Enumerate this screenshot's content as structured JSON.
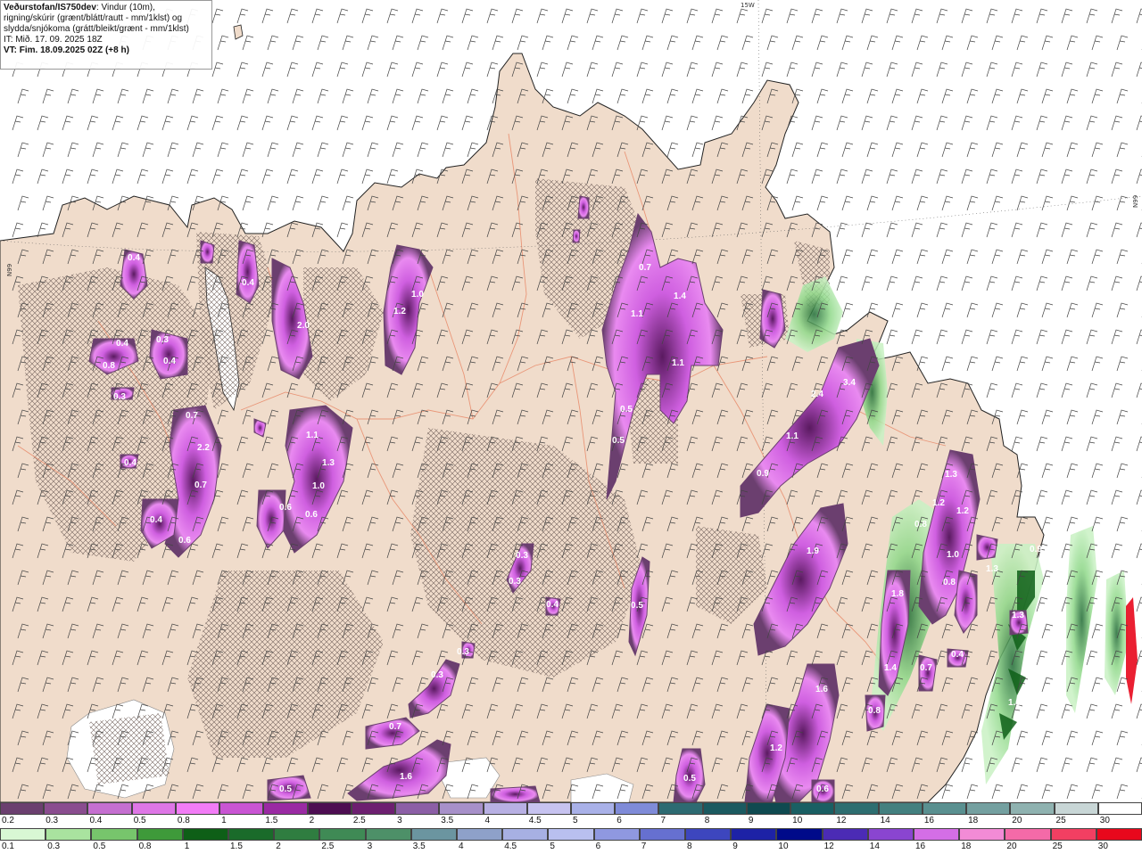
{
  "header": {
    "title_bold": "Veðurstofan/IS750dev",
    "title_rest": ": Vindur (10m),",
    "line2": "rigning/skúrir (grænt/blátt/rautt - mm/1klst) og",
    "line3": "slydda/snjókoma (grátt/bleikt/grænt - mm/1klst)",
    "it": "IT: Mið. 17. 09. 2025 18Z",
    "vt": "VT: Fim. 18.09.2025 02Z (+8 h)"
  },
  "grid_labels": {
    "top": "15W",
    "left": "N99",
    "right": "N99"
  },
  "snow_scale": {
    "labels": [
      "0.2",
      "0.3",
      "0.4",
      "0.5",
      "0.8",
      "1",
      "1.5",
      "2",
      "2.5",
      "3",
      "3.5",
      "4",
      "4.5",
      "5",
      "6",
      "7",
      "8",
      "9",
      "10",
      "12",
      "14",
      "16",
      "18",
      "20",
      "25",
      "30"
    ],
    "colors": [
      "#6b3f6f",
      "#8a4d8f",
      "#c56fd0",
      "#de76e6",
      "#f27cf6",
      "#c955d3",
      "#9a2aa3",
      "#4d0d52",
      "#6d1f70",
      "#8c5fa6",
      "#a790c9",
      "#b8b0e3",
      "#c7c3f0",
      "#a9b1e8",
      "#7f8bd8",
      "#2d6b72",
      "#1b5a60",
      "#0f4a50",
      "#1a5f63",
      "#2d6e70",
      "#43807f",
      "#5a9090",
      "#74a0a0",
      "#8fb2b0",
      "#c8d6d6",
      "#ffffff"
    ]
  },
  "rain_scale": {
    "labels": [
      "0.1",
      "0.3",
      "0.5",
      "0.8",
      "1",
      "1.5",
      "2",
      "2.5",
      "3",
      "3.5",
      "4",
      "4.5",
      "5",
      "6",
      "7",
      "8",
      "9",
      "10",
      "12",
      "14",
      "16",
      "18",
      "20",
      "25",
      "30"
    ],
    "colors": [
      "#d8f7d4",
      "#a9e39f",
      "#77c56c",
      "#3e9a3a",
      "#0e5f17",
      "#1a6b2a",
      "#2f7d40",
      "#3f8a55",
      "#4d9068",
      "#6b95a0",
      "#8ea1c9",
      "#a7b0e3",
      "#b9c0ef",
      "#8f98e0",
      "#6670d0",
      "#3d46be",
      "#1d22a6",
      "#000a8a",
      "#4b2bb5",
      "#8a45d0",
      "#d46ee6",
      "#f28bd6",
      "#f46aa8",
      "#f23f62",
      "#e8081c"
    ]
  },
  "precip_labels": [
    {
      "v": "0.4"
    },
    {
      "v": "0.4"
    },
    {
      "v": "2.0"
    },
    {
      "v": "1.2"
    },
    {
      "v": "1.0"
    },
    {
      "v": "0.7"
    },
    {
      "v": "1.1"
    },
    {
      "v": "1.4"
    },
    {
      "v": "1.1"
    },
    {
      "v": "0.5"
    },
    {
      "v": "0.5"
    },
    {
      "v": "0.4"
    },
    {
      "v": "0.3"
    },
    {
      "v": "0.8"
    },
    {
      "v": "0.4"
    },
    {
      "v": "0.3"
    },
    {
      "v": "0.7"
    },
    {
      "v": "2.2"
    },
    {
      "v": "0.4"
    },
    {
      "v": "0.7"
    },
    {
      "v": "0.4"
    },
    {
      "v": "0.6"
    },
    {
      "v": "1.1"
    },
    {
      "v": "1.3"
    },
    {
      "v": "1.0"
    },
    {
      "v": "0.6"
    },
    {
      "v": "0.6"
    },
    {
      "v": "2.4"
    },
    {
      "v": "3.4"
    },
    {
      "v": "1.1"
    },
    {
      "v": "0.9"
    },
    {
      "v": "1.3"
    },
    {
      "v": "1.2"
    },
    {
      "v": "1.2"
    },
    {
      "v": "0.8"
    },
    {
      "v": "1.0"
    },
    {
      "v": "0.8"
    },
    {
      "v": "1.8"
    },
    {
      "v": "1.4"
    },
    {
      "v": "1.3"
    },
    {
      "v": "1.9"
    },
    {
      "v": "0.5"
    },
    {
      "v": "0.3"
    },
    {
      "v": "0.3"
    },
    {
      "v": "0.4"
    },
    {
      "v": "0.3"
    },
    {
      "v": "0.3"
    },
    {
      "v": "0.7"
    },
    {
      "v": "1.6"
    },
    {
      "v": "0.5"
    },
    {
      "v": "1.6"
    },
    {
      "v": "1.2"
    },
    {
      "v": "0.6"
    },
    {
      "v": "0.5"
    },
    {
      "v": "0.8"
    },
    {
      "v": "0.7"
    },
    {
      "v": "0.4"
    },
    {
      "v": "1.3"
    },
    {
      "v": "1.6"
    },
    {
      "v": "0.9"
    }
  ]
}
